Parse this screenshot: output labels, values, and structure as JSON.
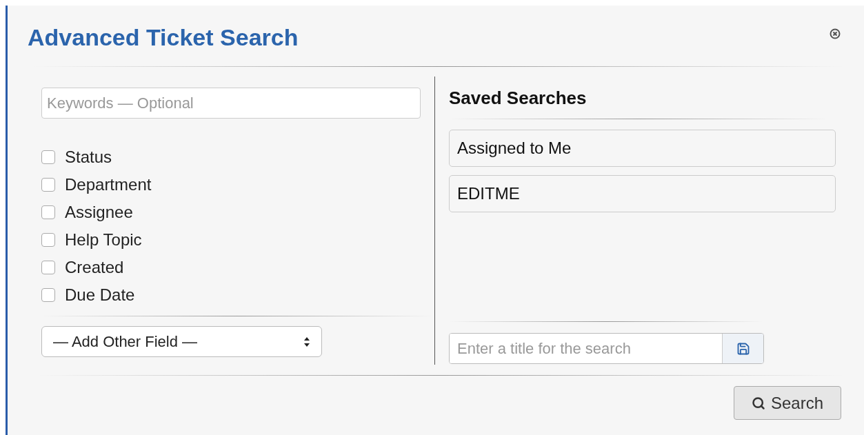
{
  "dialog": {
    "title": "Advanced Ticket Search"
  },
  "keywords": {
    "placeholder": "Keywords — Optional"
  },
  "fields": [
    {
      "label": "Status",
      "checked": false
    },
    {
      "label": "Department",
      "checked": false
    },
    {
      "label": "Assignee",
      "checked": false
    },
    {
      "label": "Help Topic",
      "checked": false
    },
    {
      "label": "Created",
      "checked": false
    },
    {
      "label": "Due Date",
      "checked": false
    }
  ],
  "add_field": {
    "value": "— Add Other Field —"
  },
  "saved_searches": {
    "heading": "Saved Searches",
    "items": [
      "Assigned to Me",
      "EDITME"
    ],
    "title_field": {
      "placeholder": "Enter a title for the search"
    }
  },
  "search_button": "Search"
}
